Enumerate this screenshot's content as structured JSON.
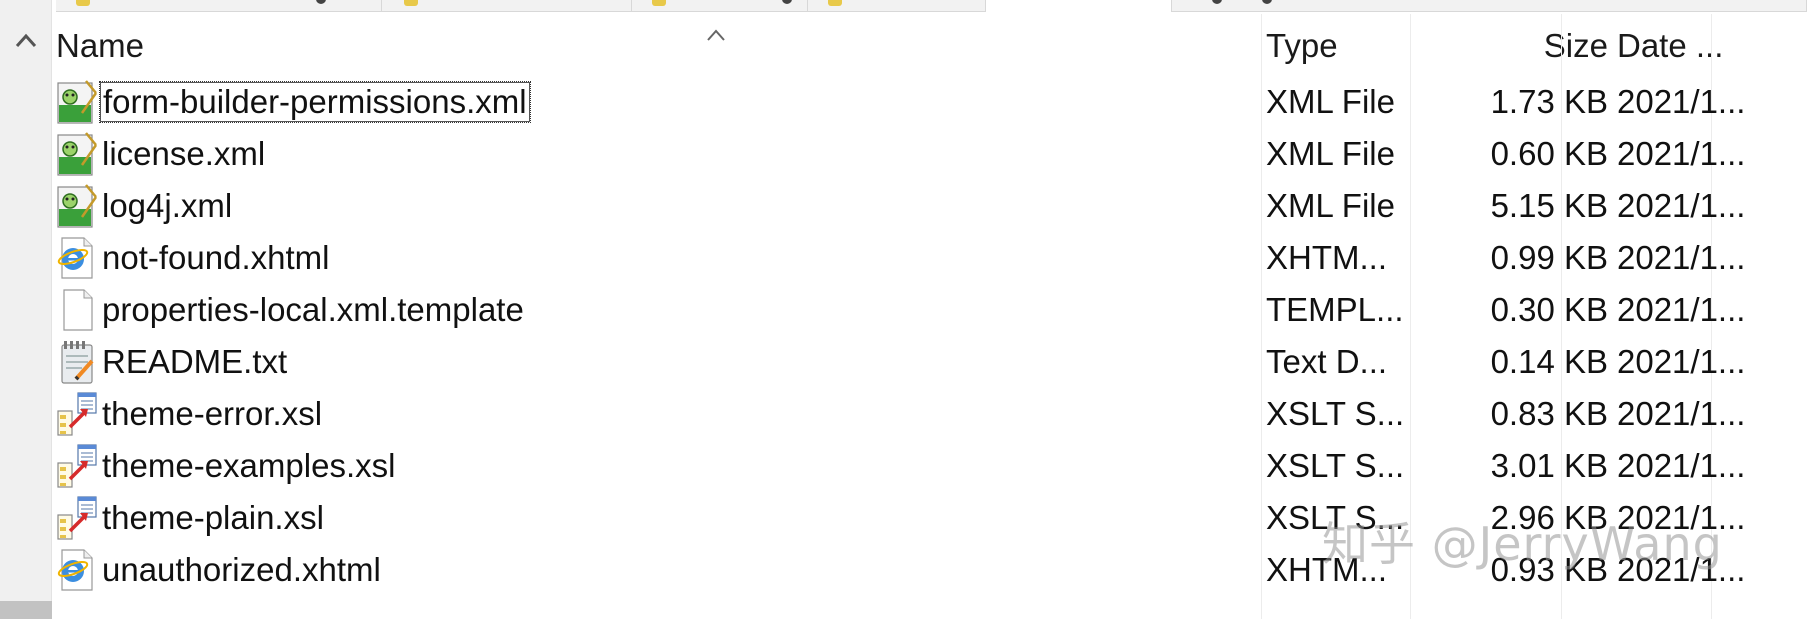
{
  "columns": {
    "name": "Name",
    "type": "Type",
    "size": "Size",
    "date": "Date ..."
  },
  "files": [
    {
      "name": "form-builder-permissions.xml",
      "icon": "xml-file-icon",
      "type": "XML File",
      "size": "1.73 KB",
      "date": "2021/1..."
    },
    {
      "name": "license.xml",
      "icon": "xml-file-icon",
      "type": "XML File",
      "size": "0.60 KB",
      "date": "2021/1..."
    },
    {
      "name": "log4j.xml",
      "icon": "xml-file-icon",
      "type": "XML File",
      "size": "5.15 KB",
      "date": "2021/1..."
    },
    {
      "name": "not-found.xhtml",
      "icon": "ie-document-icon",
      "type": "XHTM...",
      "size": "0.99 KB",
      "date": "2021/1..."
    },
    {
      "name": "properties-local.xml.template",
      "icon": "blank-file-icon",
      "type": "TEMPL...",
      "size": "0.30 KB",
      "date": "2021/1..."
    },
    {
      "name": "README.txt",
      "icon": "notepad-icon",
      "type": "Text D...",
      "size": "0.14 KB",
      "date": "2021/1..."
    },
    {
      "name": "theme-error.xsl",
      "icon": "xslt-file-icon",
      "type": "XSLT S...",
      "size": "0.83 KB",
      "date": "2021/1..."
    },
    {
      "name": "theme-examples.xsl",
      "icon": "xslt-file-icon",
      "type": "XSLT S...",
      "size": "3.01 KB",
      "date": "2021/1..."
    },
    {
      "name": "theme-plain.xsl",
      "icon": "xslt-file-icon",
      "type": "XSLT S...",
      "size": "2.96 KB",
      "date": "2021/1..."
    },
    {
      "name": "unauthorized.xhtml",
      "icon": "ie-document-icon",
      "type": "XHTM...",
      "size": "0.93 KB",
      "date": "2021/1..."
    }
  ],
  "watermark": "知乎 @JerryWang",
  "colors": {
    "scrollbar_bg": "#f0f0f0",
    "tab_bg": "#f2f2f2",
    "watermark": "#969696"
  }
}
